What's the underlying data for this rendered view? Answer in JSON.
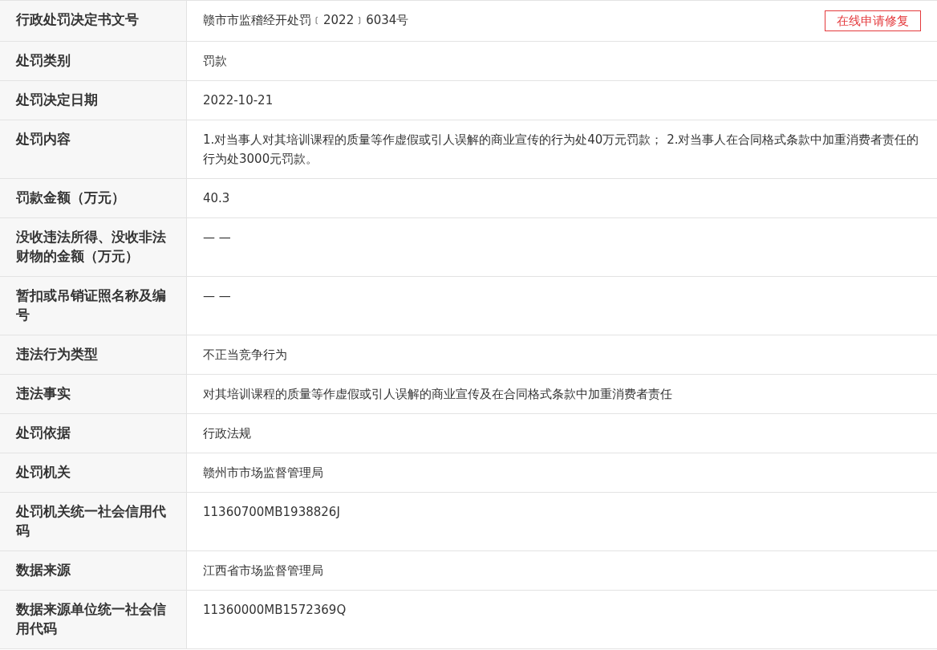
{
  "action_button": {
    "label": "在线申请修复"
  },
  "rows": [
    {
      "label": "行政处罚决定书文号",
      "value": "赣市市监稽经开处罚﹝2022﹞6034号"
    },
    {
      "label": "处罚类别",
      "value": "罚款"
    },
    {
      "label": "处罚决定日期",
      "value": "2022-10-21"
    },
    {
      "label": "处罚内容",
      "value": "1.对当事人对其培训课程的质量等作虚假或引人误解的商业宣传的行为处40万元罚款； 2.对当事人在合同格式条款中加重消费者责任的行为处3000元罚款。"
    },
    {
      "label": "罚款金额（万元）",
      "value": "40.3"
    },
    {
      "label": "没收违法所得、没收非法财物的金额（万元）",
      "value": "— —"
    },
    {
      "label": "暂扣或吊销证照名称及编号",
      "value": "— —"
    },
    {
      "label": "违法行为类型",
      "value": "不正当竞争行为"
    },
    {
      "label": "违法事实",
      "value": "对其培训课程的质量等作虚假或引人误解的商业宣传及在合同格式条款中加重消费者责任"
    },
    {
      "label": "处罚依据",
      "value": "行政法规"
    },
    {
      "label": "处罚机关",
      "value": "赣州市市场监督管理局"
    },
    {
      "label": "处罚机关统一社会信用代码",
      "value": "11360700MB1938826J"
    },
    {
      "label": "数据来源",
      "value": "江西省市场监督管理局"
    },
    {
      "label": "数据来源单位统一社会信用代码",
      "value": "11360000MB1572369Q"
    }
  ]
}
